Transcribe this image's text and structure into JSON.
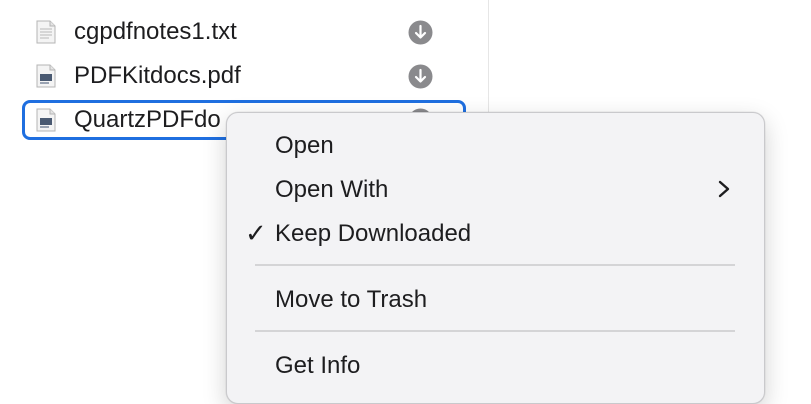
{
  "files": [
    {
      "name": "cgpdfnotes1.txt",
      "icon": "text-file-icon",
      "status_icon": "download-icon",
      "selected": false
    },
    {
      "name": "PDFKitdocs.pdf",
      "icon": "pdf-file-icon",
      "status_icon": "download-icon",
      "selected": false
    },
    {
      "name": "QuartzPDFdo",
      "icon": "pdf-file-icon",
      "status_icon": "download-icon",
      "selected": true
    }
  ],
  "context_menu": {
    "items": [
      {
        "label": "Open"
      },
      {
        "label": "Open With",
        "submenu": true
      },
      {
        "label": "Keep Downloaded",
        "checked": true,
        "check_glyph": "✓"
      },
      {
        "label": "Move to Trash"
      },
      {
        "label": "Get Info"
      }
    ]
  },
  "colors": {
    "selection_border": "#1f6fe0",
    "download_icon": "#8a8a8d",
    "menu_background": "#f3f3f5"
  }
}
